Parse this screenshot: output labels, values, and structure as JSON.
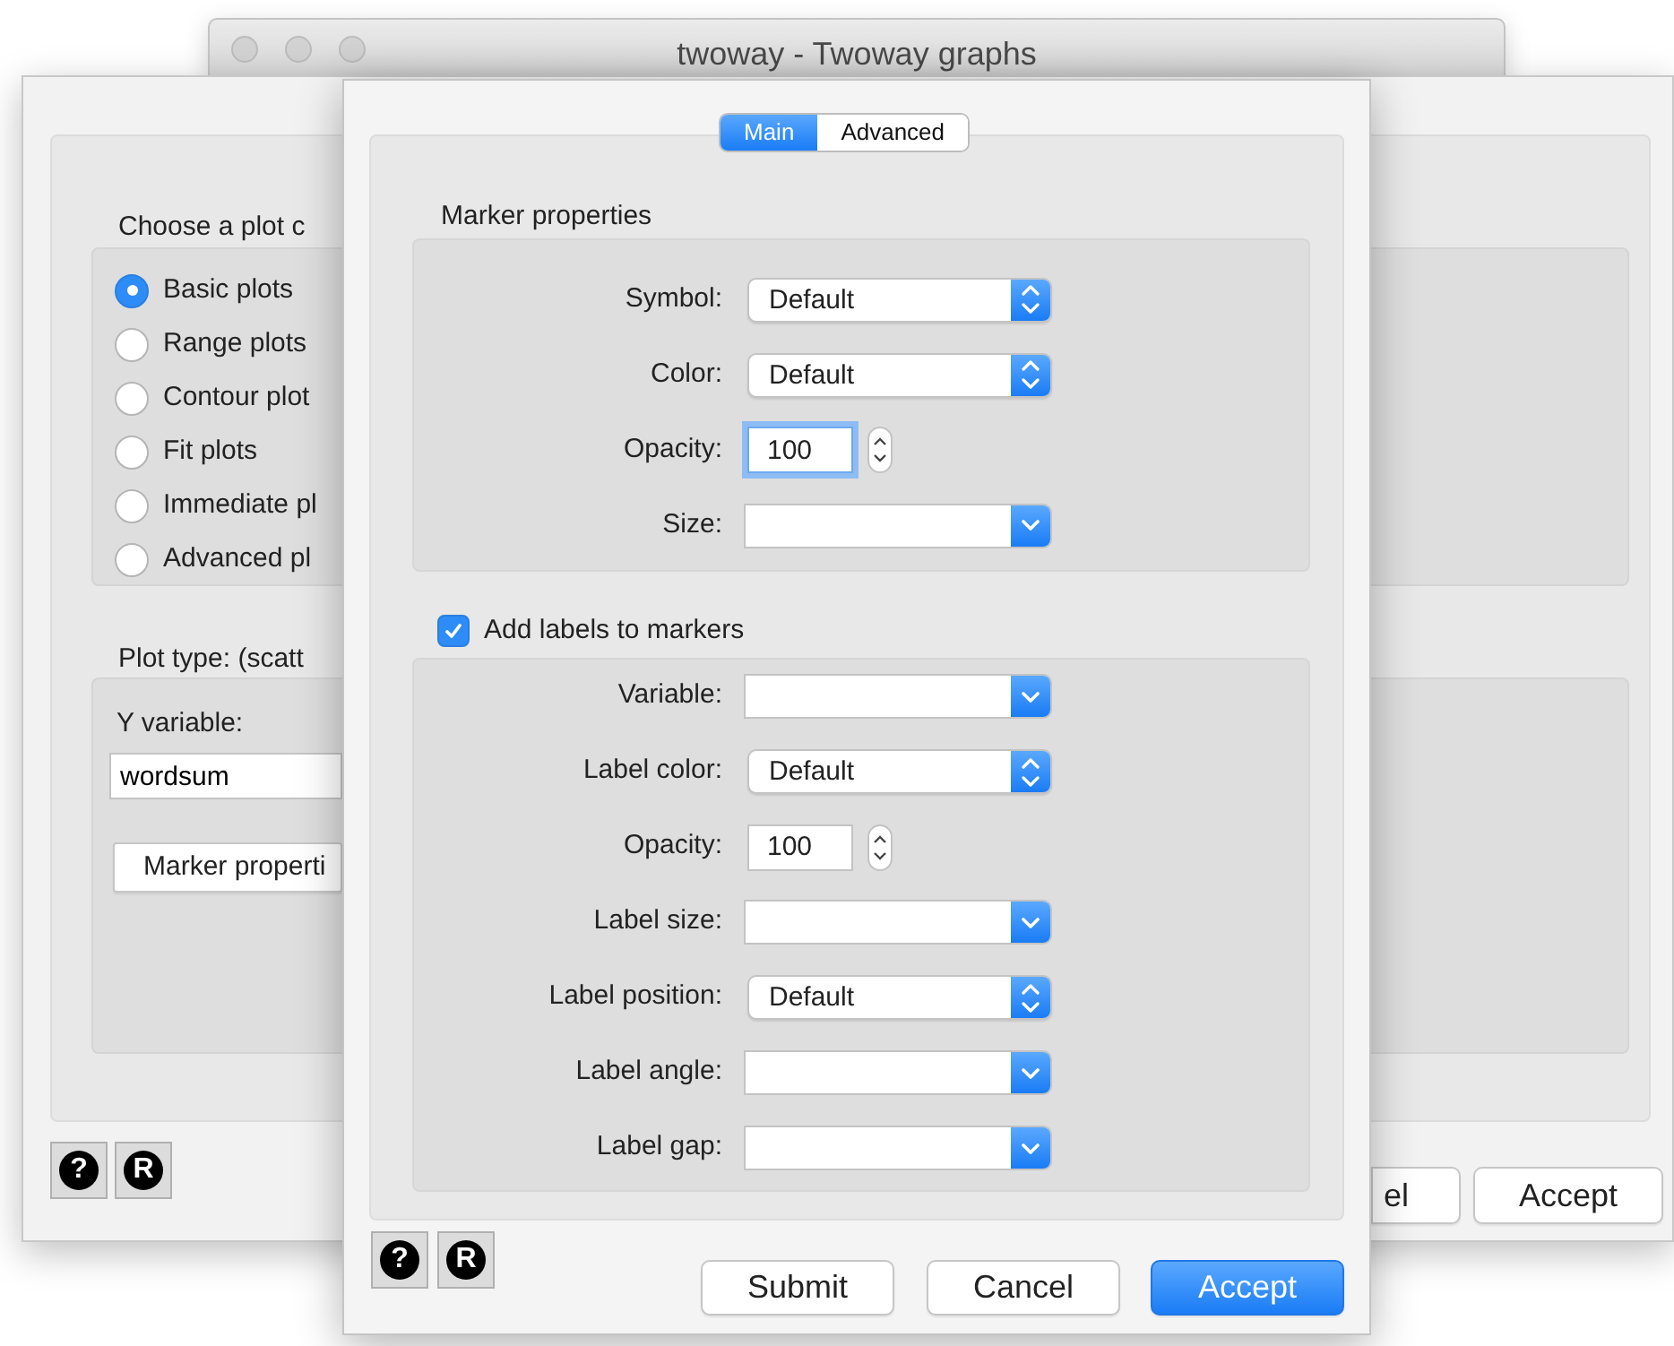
{
  "window": {
    "title": "twoway - Twoway graphs"
  },
  "back_dialog": {
    "category_group_label": "Choose a plot c",
    "plot_categories": [
      {
        "label": "Basic plots",
        "selected": true
      },
      {
        "label": "Range plots",
        "selected": false
      },
      {
        "label": "Contour plot",
        "selected": false
      },
      {
        "label": "Fit plots",
        "selected": false
      },
      {
        "label": "Immediate pl",
        "selected": false
      },
      {
        "label": "Advanced pl",
        "selected": false
      }
    ],
    "plot_type_label": "Plot type: (scatt",
    "y_variable": {
      "label": "Y variable:",
      "value": "wordsum"
    },
    "marker_button": "Marker properti",
    "tool_buttons": [
      "?",
      "R"
    ],
    "buttons": [
      {
        "label": "el",
        "primary": false
      },
      {
        "label": "Accept",
        "primary": false
      }
    ]
  },
  "sheet": {
    "tabs": [
      {
        "label": "Main",
        "selected": true
      },
      {
        "label": "Advanced",
        "selected": false
      }
    ],
    "marker_section": {
      "title": "Marker properties",
      "rows": [
        {
          "kind": "popup",
          "label": "Symbol:",
          "value": "Default"
        },
        {
          "kind": "popup",
          "label": "Color:",
          "value": "Default"
        },
        {
          "kind": "spinner",
          "label": "Opacity:",
          "value": "100",
          "focused": true
        },
        {
          "kind": "combo",
          "label": "Size:"
        }
      ]
    },
    "labels_section": {
      "title": "Add labels to markers",
      "checked": true,
      "rows": [
        {
          "kind": "combo",
          "label": "Variable:"
        },
        {
          "kind": "popup",
          "label": "Label color:",
          "value": "Default"
        },
        {
          "kind": "spinner",
          "label": "Opacity:",
          "value": "100",
          "focused": false
        },
        {
          "kind": "combo",
          "label": "Label size:"
        },
        {
          "kind": "popup",
          "label": "Label position:",
          "value": "Default"
        },
        {
          "kind": "combo",
          "label": "Label angle:"
        },
        {
          "kind": "combo",
          "label": "Label gap:"
        }
      ]
    },
    "tool_buttons": [
      "?",
      "R"
    ],
    "buttons": [
      {
        "label": "Submit",
        "primary": false
      },
      {
        "label": "Cancel",
        "primary": false
      },
      {
        "label": "Accept",
        "primary": true
      }
    ]
  }
}
